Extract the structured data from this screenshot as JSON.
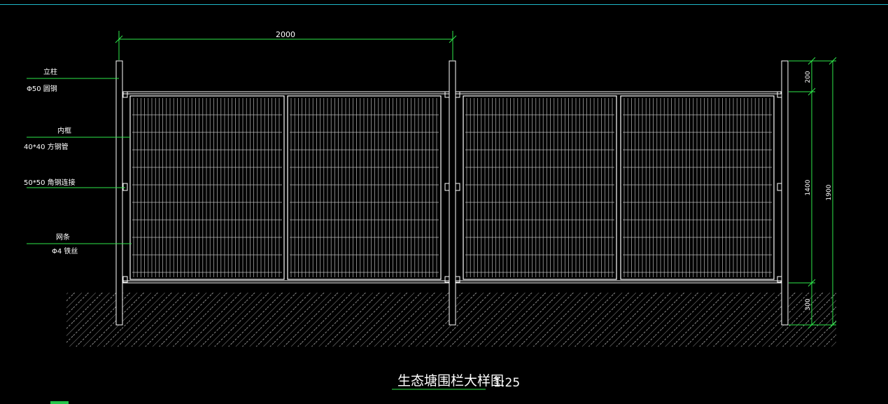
{
  "drawing": {
    "top_dimension": "2000",
    "labels": [
      {
        "line1": "立柱",
        "line2": "Φ50 圆钢"
      },
      {
        "line1": "内框",
        "line2": "40*40  方钢管"
      },
      {
        "line1": "50*50  角钢连接",
        "line2": ""
      },
      {
        "line1": "网条",
        "line2": "Φ4 铁丝"
      }
    ],
    "right_dims": {
      "top": "200",
      "middle": "1400",
      "bottom": "300",
      "total": "1900"
    },
    "title": "生态塘围栏大样图",
    "scale": "1:25"
  },
  "colors": {
    "background": "#000000",
    "lines": "#ffffff",
    "dimensions": "#2ee84a",
    "accent": "#1fb7c9"
  }
}
